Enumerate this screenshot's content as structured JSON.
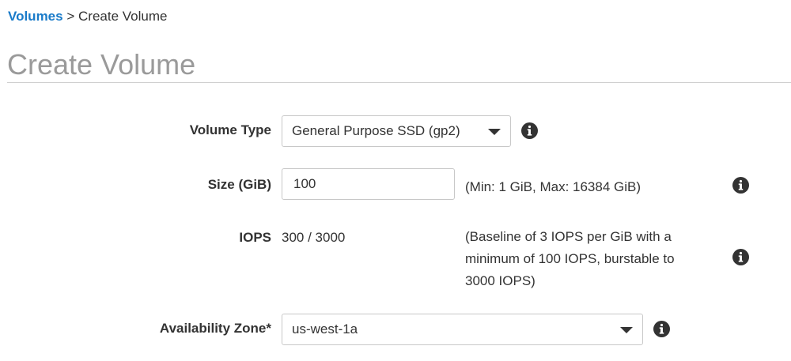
{
  "breadcrumb": {
    "link_label": "Volumes",
    "separator": ">",
    "current": "Create Volume"
  },
  "page": {
    "title": "Create Volume"
  },
  "form": {
    "volume_type": {
      "label": "Volume Type",
      "value": "General Purpose SSD (gp2)"
    },
    "size": {
      "label": "Size (GiB)",
      "value": "100",
      "help": "(Min: 1 GiB, Max: 16384 GiB)"
    },
    "iops": {
      "label": "IOPS",
      "value": "300 / 3000",
      "help_lines": [
        "(Baseline of 3 IOPS per GiB with a",
        "minimum of 100 IOPS, burstable to",
        "3000 IOPS)"
      ]
    },
    "availability_zone": {
      "label": "Availability Zone*",
      "value": "us-west-1a"
    }
  },
  "icons": {
    "info": "info-circle-icon",
    "dropdown": "caret-down-icon"
  },
  "colors": {
    "link": "#1a7bc9",
    "title": "#9a9a9a",
    "text": "#333333",
    "border": "#c8c8c8"
  }
}
